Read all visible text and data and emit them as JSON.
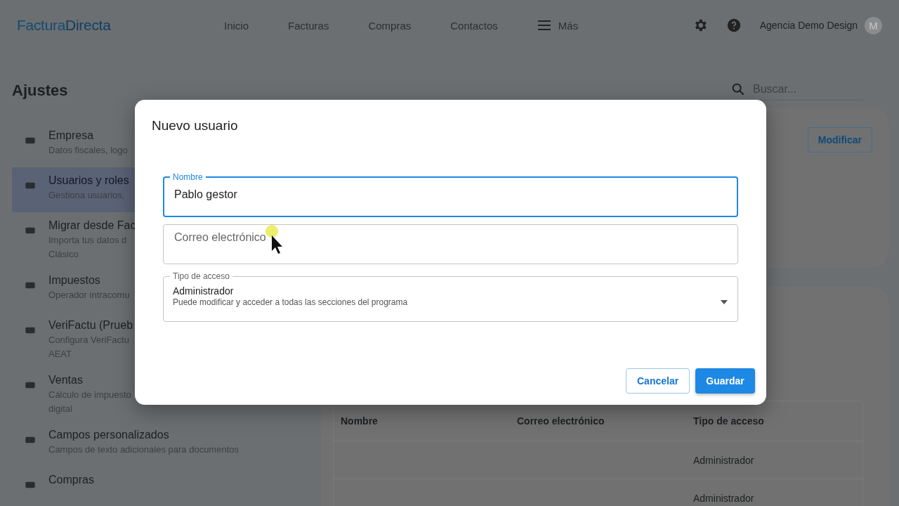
{
  "header": {
    "logo": {
      "first": "Factura",
      "second": "Directa"
    },
    "nav": [
      {
        "label": "Inicio",
        "kind": "link"
      },
      {
        "label": "Facturas",
        "kind": "link"
      },
      {
        "label": "Compras",
        "kind": "link"
      },
      {
        "label": "Contactos",
        "kind": "link"
      },
      {
        "label": "Más",
        "kind": "menu"
      }
    ],
    "account": {
      "name": "Agencia Demo Design",
      "avatar": "M"
    }
  },
  "page": {
    "title": "Ajustes",
    "search": {
      "placeholder": "Buscar..."
    }
  },
  "sidebar": {
    "items": [
      {
        "title": "Empresa",
        "subtitle": [
          "Datos fiscales, logo"
        ],
        "selected": false
      },
      {
        "title": "Usuarios y roles",
        "subtitle": [
          "Gestiona usuarios,"
        ],
        "selected": true
      },
      {
        "title": "Migrar desde Fac",
        "subtitle": [
          "Importa tus datos d",
          "Clásico"
        ],
        "selected": false
      },
      {
        "title": "Impuestos",
        "subtitle": [
          "Operador intracomu"
        ],
        "selected": false
      },
      {
        "title": "VeriFactu (Prueb",
        "subtitle": [
          "Configura VeriFactu",
          "AEAT"
        ],
        "selected": false
      },
      {
        "title": "Ventas",
        "subtitle": [
          "Cálculo de impuesto",
          "digital"
        ],
        "selected": false
      },
      {
        "title": "Campos personalizados",
        "subtitle": [
          "Campos de texto adicionales para documentos"
        ],
        "selected": false
      },
      {
        "title": "Compras",
        "selected": false
      }
    ]
  },
  "company_card": {
    "button": "Modificar"
  },
  "users_table": {
    "columns": [
      "Nombre",
      "Correo electrónico",
      "Tipo de acceso"
    ],
    "rows": [
      {
        "access": "Administrador"
      },
      {
        "access": "Administrador"
      }
    ]
  },
  "dialog": {
    "title": "Nuevo usuario",
    "fields": [
      {
        "kind": "text",
        "label": "Nombre",
        "value": "Pablo gestor",
        "focused": true
      },
      {
        "kind": "text",
        "placeholder": "Correo electrónico",
        "focused": false
      },
      {
        "kind": "select",
        "label": "Tipo de acceso",
        "value": "Administrador",
        "description": "Puede modificar y acceder a todas las secciones del programa",
        "focused": false
      }
    ],
    "buttons": [
      {
        "label": "Cancelar",
        "kind": "outlined"
      },
      {
        "label": "Guardar",
        "kind": "primary"
      }
    ]
  }
}
